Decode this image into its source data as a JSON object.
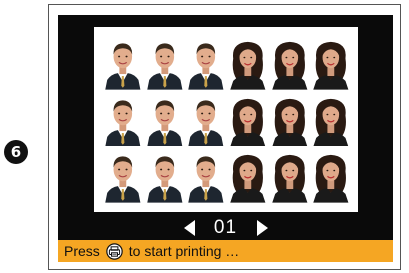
{
  "step": {
    "number": "6"
  },
  "sheet": {
    "grid": [
      [
        "man",
        "man",
        "man",
        "woman",
        "woman",
        "woman"
      ],
      [
        "man",
        "man",
        "man",
        "woman",
        "woman",
        "woman"
      ],
      [
        "man",
        "man",
        "man",
        "woman",
        "woman",
        "woman"
      ]
    ]
  },
  "pager": {
    "page": "01"
  },
  "status": {
    "prefix": "Press",
    "icon": "print-button-icon",
    "suffix": "to start printing …"
  },
  "colors": {
    "screen": "#0a0a0a",
    "status_bar": "#f5a623",
    "sheet": "#ffffff"
  }
}
